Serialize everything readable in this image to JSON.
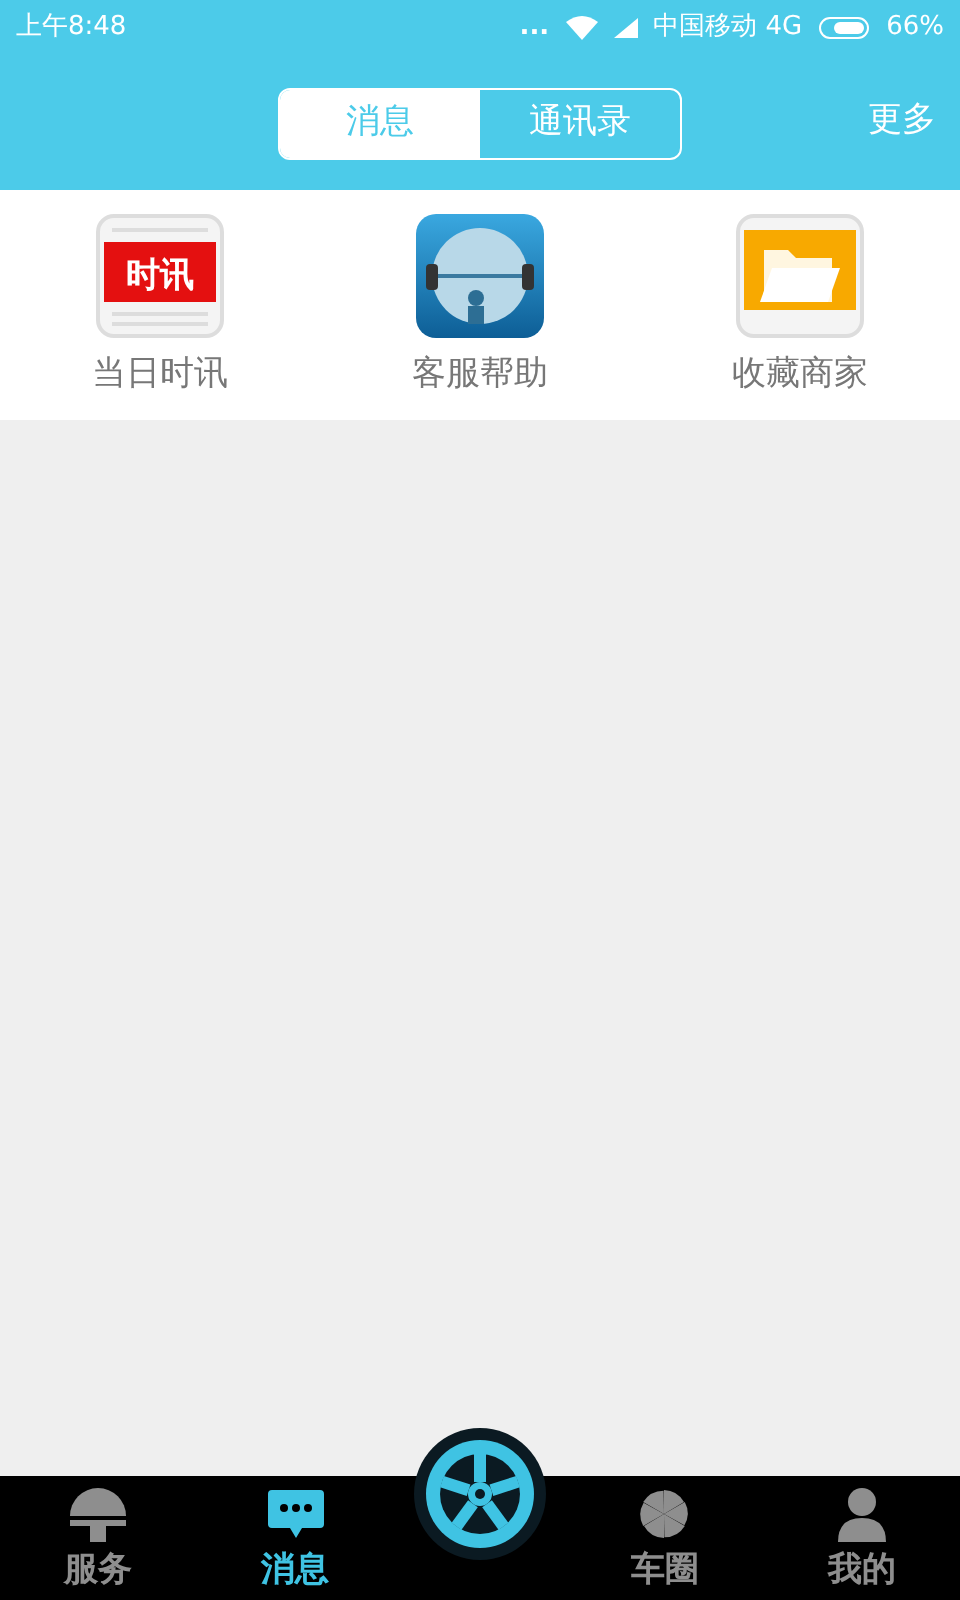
{
  "status_bar": {
    "time": "上午8:48",
    "dots": "...",
    "carrier": "中国移动 4G",
    "battery": "66%"
  },
  "header": {
    "tabs": [
      {
        "label": "消息",
        "selected": true
      },
      {
        "label": "通讯录",
        "selected": false
      }
    ],
    "more": "更多"
  },
  "shortcuts": [
    {
      "kind": "news",
      "label": "当日时讯",
      "icon_text": "时讯"
    },
    {
      "kind": "support",
      "label": "客服帮助"
    },
    {
      "kind": "folder",
      "label": "收藏商家"
    }
  ],
  "bottom_nav": [
    {
      "kind": "service",
      "label": "服务",
      "selected": false
    },
    {
      "kind": "message",
      "label": "消息",
      "selected": true
    },
    {
      "kind": "center"
    },
    {
      "kind": "circle",
      "label": "车圈",
      "selected": false
    },
    {
      "kind": "profile",
      "label": "我的",
      "selected": false
    }
  ]
}
